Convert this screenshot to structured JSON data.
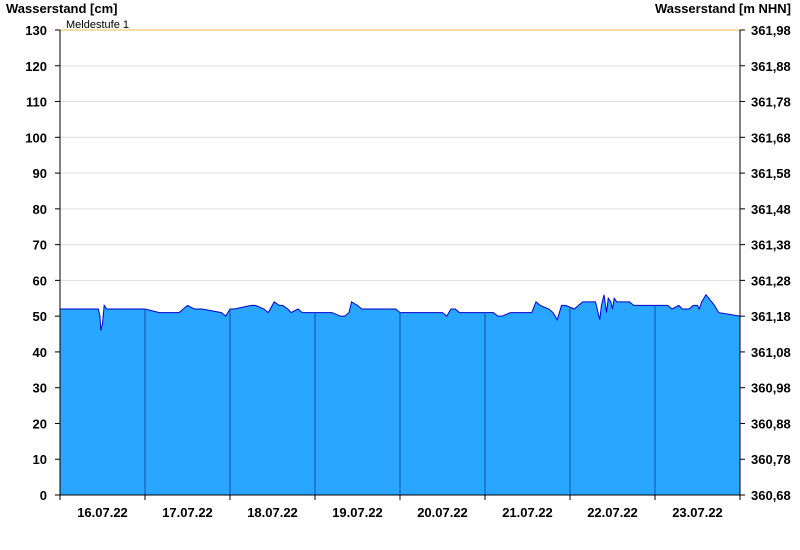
{
  "chart_data": {
    "type": "area",
    "ylabel_left": "Wasserstand [cm]",
    "ylabel_right": "Wasserstand [m NHN]",
    "ylim": [
      0,
      130
    ],
    "yticks": [
      0,
      10,
      20,
      30,
      40,
      50,
      60,
      70,
      80,
      90,
      100,
      110,
      120,
      130
    ],
    "yticks_right": [
      "360,68",
      "360,78",
      "360,88",
      "360,98",
      "361,08",
      "361,18",
      "361,28",
      "361,38",
      "361,48",
      "361,58",
      "361,68",
      "361,78",
      "361,88",
      "361,98"
    ],
    "x_tick_labels": [
      "16.07.22",
      "17.07.22",
      "18.07.22",
      "19.07.22",
      "20.07.22",
      "21.07.22",
      "22.07.22",
      "23.07.22"
    ],
    "xlim_days": [
      0,
      8
    ],
    "grid": true,
    "fill_color": "#29a6ff",
    "line_color": "#0000cc",
    "threshold": {
      "label": "Meldestufe 1",
      "value": 130,
      "color": "#f2c86e"
    },
    "series": [
      {
        "x": [
          0,
          0.45,
          0.47,
          0.48,
          0.5,
          0.52,
          0.55,
          1.0,
          1.17,
          1.4,
          1.45,
          1.5,
          1.58,
          1.67,
          1.9,
          1.95,
          2.0,
          2.05,
          2.25,
          2.3,
          2.4,
          2.45,
          2.52,
          2.58,
          2.62,
          2.68,
          2.72,
          2.8,
          2.85,
          2.9,
          2.95,
          3.2,
          3.3,
          3.35,
          3.4,
          3.43,
          3.5,
          3.55,
          3.95,
          4.0,
          4.5,
          4.55,
          4.6,
          4.65,
          4.7,
          4.75,
          4.9,
          5.1,
          5.15,
          5.2,
          5.3,
          5.55,
          5.6,
          5.65,
          5.75,
          5.8,
          5.85,
          5.9,
          5.95,
          6.05,
          6.1,
          6.15,
          6.3,
          6.32,
          6.35,
          6.37,
          6.4,
          6.43,
          6.45,
          6.48,
          6.5,
          6.52,
          6.55,
          6.58,
          6.6,
          6.7,
          6.75,
          6.85,
          7.0,
          7.15,
          7.2,
          7.28,
          7.32,
          7.4,
          7.45,
          7.5,
          7.52,
          7.55,
          7.6,
          7.7,
          7.75,
          8.0
        ],
        "y": [
          52,
          52,
          50,
          46,
          48,
          53,
          52,
          52,
          51,
          51,
          52,
          53,
          52,
          52,
          51,
          50,
          52,
          52,
          53,
          53,
          52,
          51,
          54,
          53,
          53,
          52,
          51,
          52,
          51,
          51,
          51,
          51,
          50,
          50,
          51,
          54,
          53,
          52,
          52,
          51,
          51,
          50,
          52,
          52,
          51,
          51,
          51,
          51,
          50,
          50,
          51,
          51,
          54,
          53,
          52,
          51,
          49,
          53,
          53,
          52,
          53,
          54,
          54,
          52,
          49,
          53,
          56,
          51,
          55,
          54,
          52,
          55,
          54,
          54,
          54,
          54,
          53,
          53,
          53,
          53,
          52,
          53,
          52,
          52,
          53,
          53,
          52,
          54,
          56,
          53,
          51,
          50
        ]
      }
    ]
  }
}
